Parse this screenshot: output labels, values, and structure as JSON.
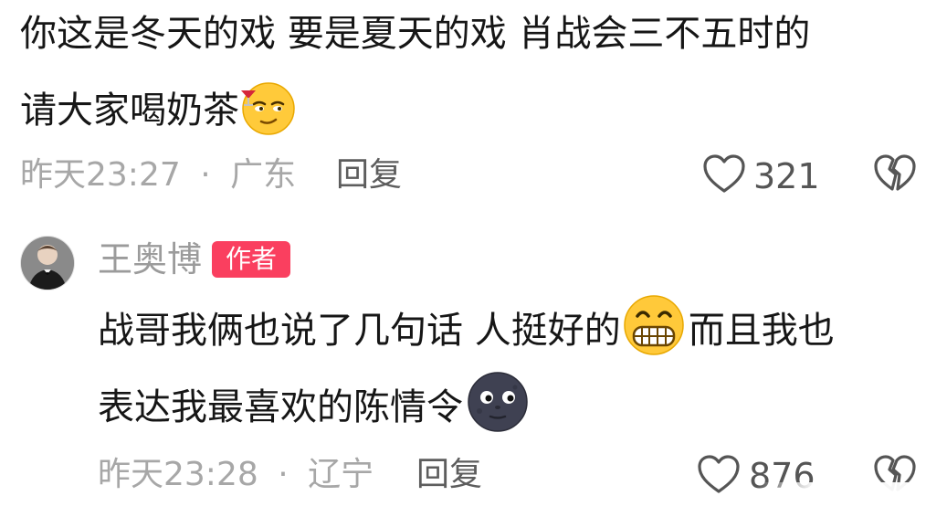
{
  "comments": [
    {
      "text_line1": "你这是冬天的戏 要是夏天的戏 肖战会三不五时的",
      "text_line2": "请大家喝奶茶",
      "emoji": "smirk-cocktail-emoji",
      "time": "昨天23:27",
      "dot": "·",
      "location": "广东",
      "reply_label": "回复",
      "likes": "321",
      "dislike_icon": "broken-heart-icon",
      "like_icon": "heart-outline-icon"
    },
    {
      "author": "王奥博",
      "badge": "作者",
      "text_line1": "战哥我俩也说了几句话 人挺好的",
      "text_line1_after": "而且我也",
      "text_line2": "表达我最喜欢的陈情令",
      "emoji_line1": "grinning-teeth-emoji",
      "emoji_line2": "new-moon-face-emoji",
      "time": "昨天23:28",
      "dot": "·",
      "location": "辽宁",
      "reply_label": "回复",
      "likes": "876",
      "dislike_icon": "broken-heart-icon",
      "like_icon": "heart-outline-icon"
    }
  ],
  "colors": {
    "text": "#161616",
    "meta": "#a7a7a7",
    "badge": "#fa3f5f"
  }
}
